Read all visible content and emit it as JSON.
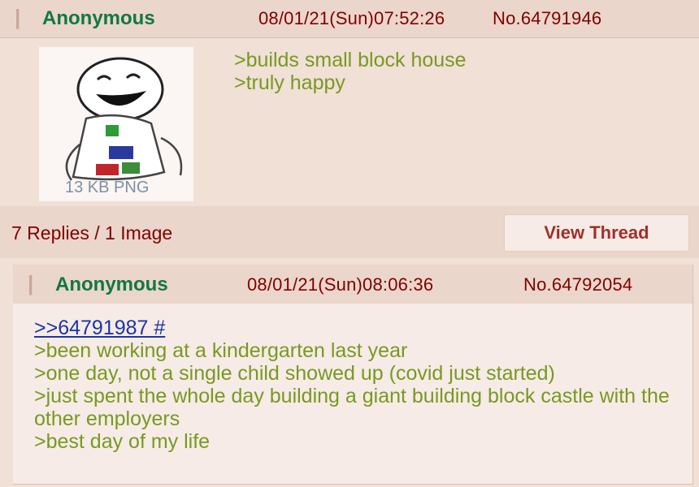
{
  "op": {
    "name": "Anonymous",
    "datetime": "08/01/21(Sun)07:52:26",
    "post_no": "No.64791946",
    "thumb_caption": "13 KB PNG",
    "lines": [
      ">builds small block house",
      ">truly happy"
    ],
    "replies_summary": "7 Replies / 1 Image",
    "view_thread_label": "View Thread"
  },
  "reply": {
    "name": "Anonymous",
    "datetime": "08/01/21(Sun)08:06:36",
    "post_no": "No.64792054",
    "quote_link": ">>64791987 #",
    "lines": [
      ">been working at a kindergarten last year",
      ">one day, not a single child showed up (covid just started)",
      ">just spent the whole day building a giant building block castle with the other employers",
      ">best day of my life"
    ]
  },
  "colors": {
    "background": "#f0e0d6",
    "name_green": "#117743",
    "greentext": "#789922",
    "quote_link": "#1a36a8",
    "meta_maroon": "#800000"
  }
}
